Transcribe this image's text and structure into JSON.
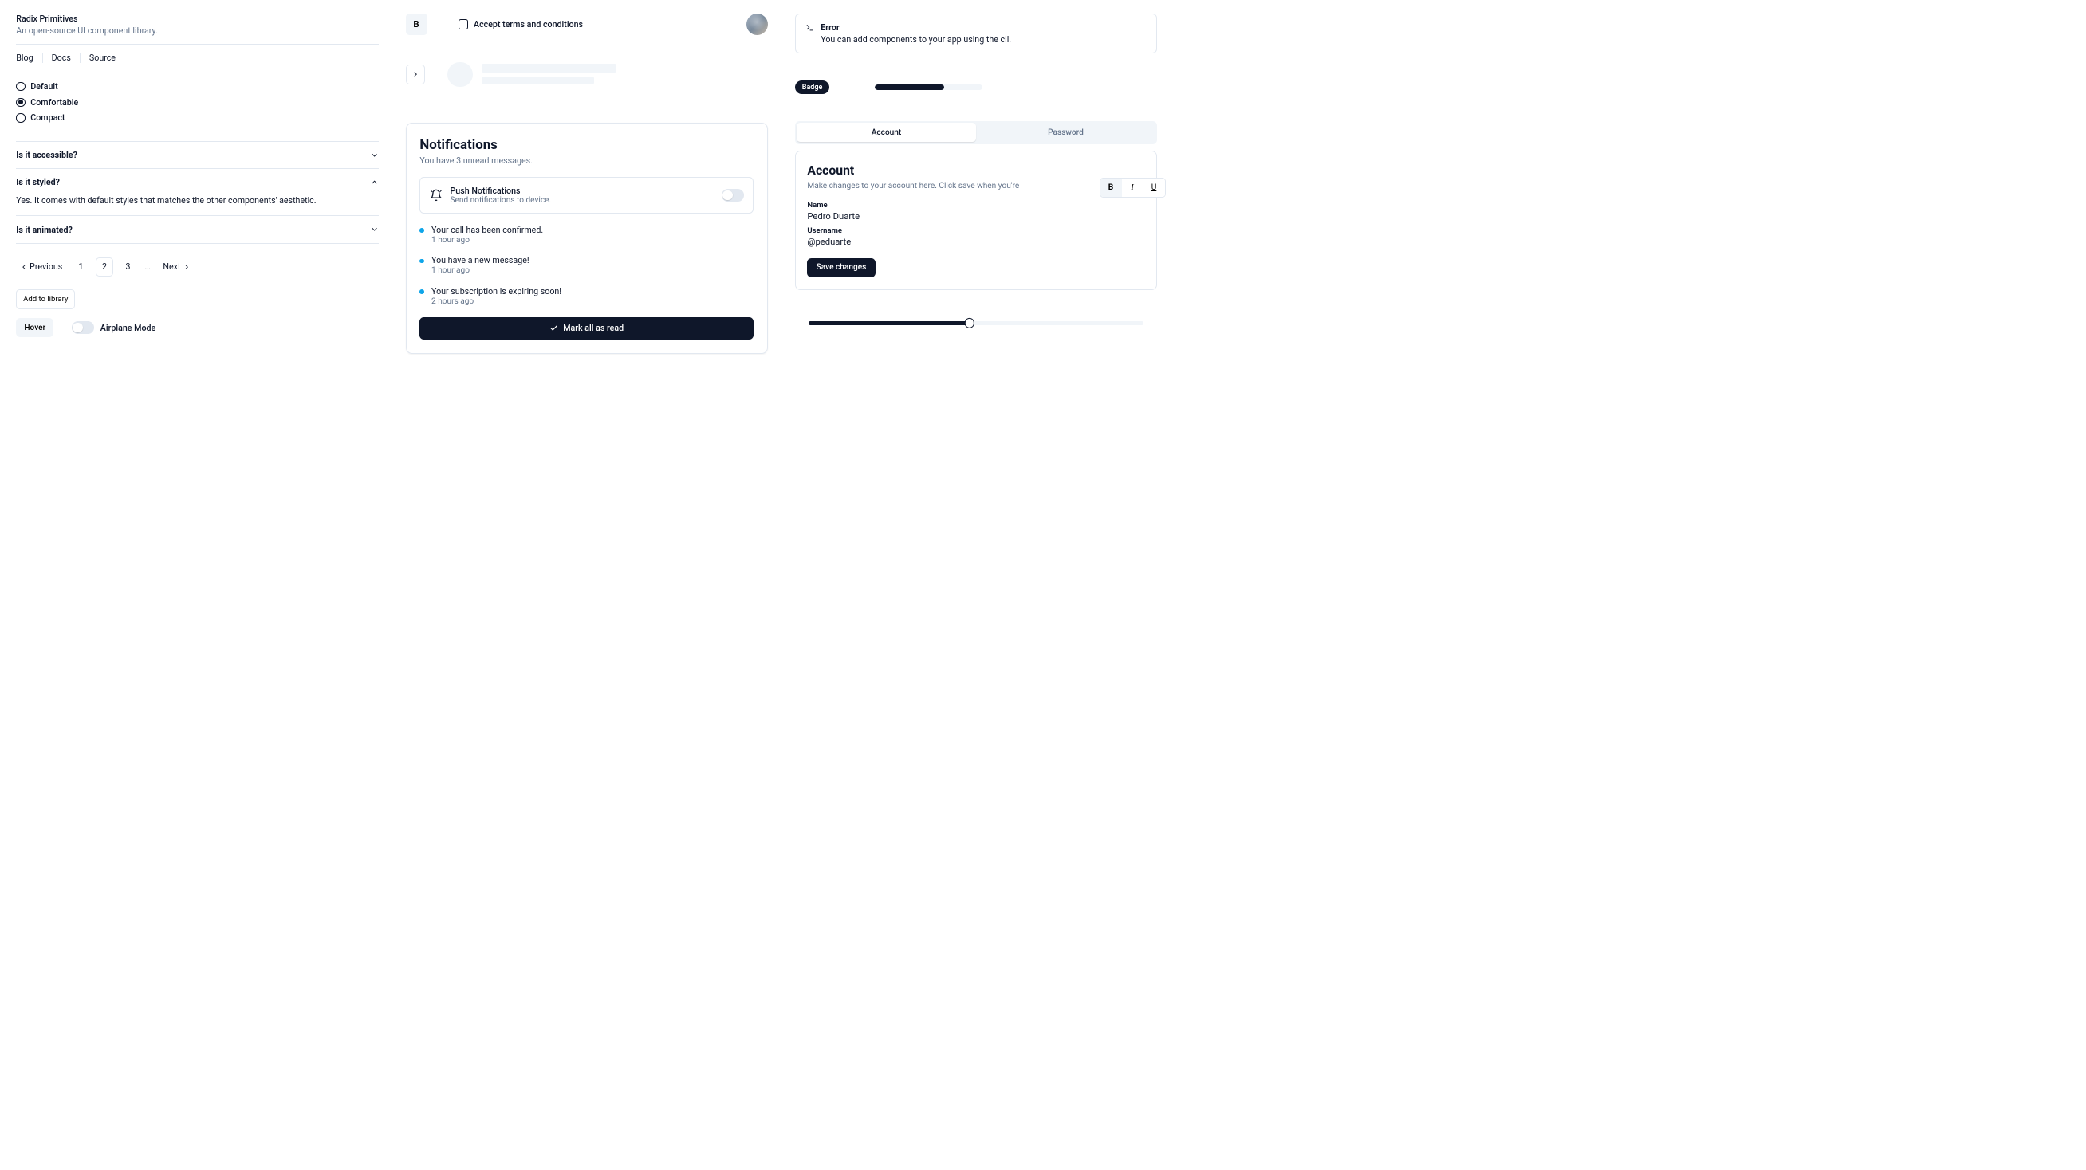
{
  "header": {
    "title": "Radix Primitives",
    "subtitle": "An open-source UI component library."
  },
  "nav": {
    "blog": "Blog",
    "docs": "Docs",
    "source": "Source"
  },
  "radio": {
    "options": [
      {
        "label": "Default",
        "selected": false
      },
      {
        "label": "Comfortable",
        "selected": true
      },
      {
        "label": "Compact",
        "selected": false
      }
    ]
  },
  "accordion": {
    "items": [
      {
        "title": "Is it accessible?",
        "open": false
      },
      {
        "title": "Is it styled?",
        "open": true,
        "content": "Yes. It comes with default styles that matches the other components' aesthetic."
      },
      {
        "title": "Is it animated?",
        "open": false
      }
    ]
  },
  "pagination": {
    "previous": "Previous",
    "next": "Next",
    "pages": [
      "1",
      "2",
      "3"
    ],
    "active": "2",
    "ellipsis": "…"
  },
  "add_library": "Add to library",
  "hover_label": "Hover",
  "airplane": {
    "label": "Airplane Mode",
    "checked": false
  },
  "toggle_b": "B",
  "checkbox": {
    "label": "Accept terms and conditions",
    "checked": false
  },
  "notifications": {
    "title": "Notifications",
    "subtitle": "You have 3 unread messages.",
    "push": {
      "title": "Push Notifications",
      "subtitle": "Send notifications to device.",
      "enabled": false
    },
    "items": [
      {
        "text": "Your call has been confirmed.",
        "time": "1 hour ago"
      },
      {
        "text": "You have a new message!",
        "time": "1 hour ago"
      },
      {
        "text": "Your subscription is expiring soon!",
        "time": "2 hours ago"
      }
    ],
    "mark_all": "Mark all as read"
  },
  "alert": {
    "title": "Error",
    "body": "You can add components to your app using the cli."
  },
  "badge": {
    "label": "Badge"
  },
  "progress": {
    "percent": 65
  },
  "tabs": {
    "list": [
      {
        "label": "Account",
        "active": true
      },
      {
        "label": "Password",
        "active": false
      }
    ],
    "panel": {
      "title": "Account",
      "subtitle": "Make changes to your account here. Click save when you're",
      "name_label": "Name",
      "name_value": "Pedro Duarte",
      "username_label": "Username",
      "username_value": "@peduarte",
      "save": "Save changes"
    }
  },
  "toggle_group": {
    "bold": "B",
    "bold_active": true,
    "italic_active": false,
    "underline_active": false
  },
  "slider": {
    "percent": 48
  }
}
